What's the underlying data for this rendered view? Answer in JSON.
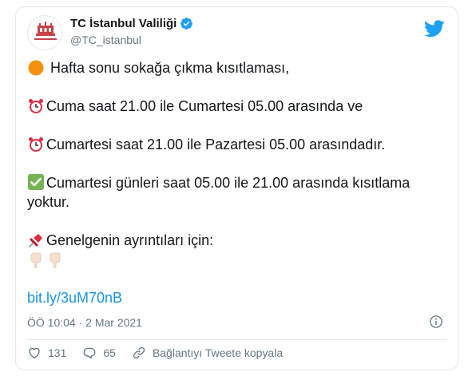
{
  "tweet": {
    "display_name": "TC İstanbul Valiliği",
    "handle": "@TC_istanbul",
    "avatar_text": "TC İSTANBUL VALİLİĞİ",
    "lines": {
      "l1": "Hafta sonu sokağa çıkma kısıtlaması,",
      "l2": "Cuma saat 21.00 ile Cumartesi 05.00 arasında ve",
      "l3": "Cumartesi saat 21.00 ile Pazartesi 05.00 arasındadır.",
      "l4": "Cumartesi günleri saat 05.00 ile 21.00 arasında kısıtlama yoktur.",
      "l5": "Genelgenin ayrıntıları için:"
    },
    "link": "bit.ly/3uM70nB",
    "timestamp": "ÖÖ 10:04 · 2 Mar 2021",
    "likes": "131",
    "replies": "65",
    "copy_link_label": "Bağlantıyı Tweete kopyala"
  },
  "colors": {
    "link": "#1b95e0",
    "meta": "#657786",
    "verified": "#1da1f2",
    "like_icon": "#e0245e"
  },
  "icons": [
    "verified-badge-icon",
    "twitter-bird-icon",
    "orange-circle-icon",
    "alarm-clock-icon",
    "check-mark-button-icon",
    "pushpin-icon",
    "pointing-down-icon",
    "info-icon",
    "heart-icon",
    "reply-icon",
    "link-icon"
  ]
}
